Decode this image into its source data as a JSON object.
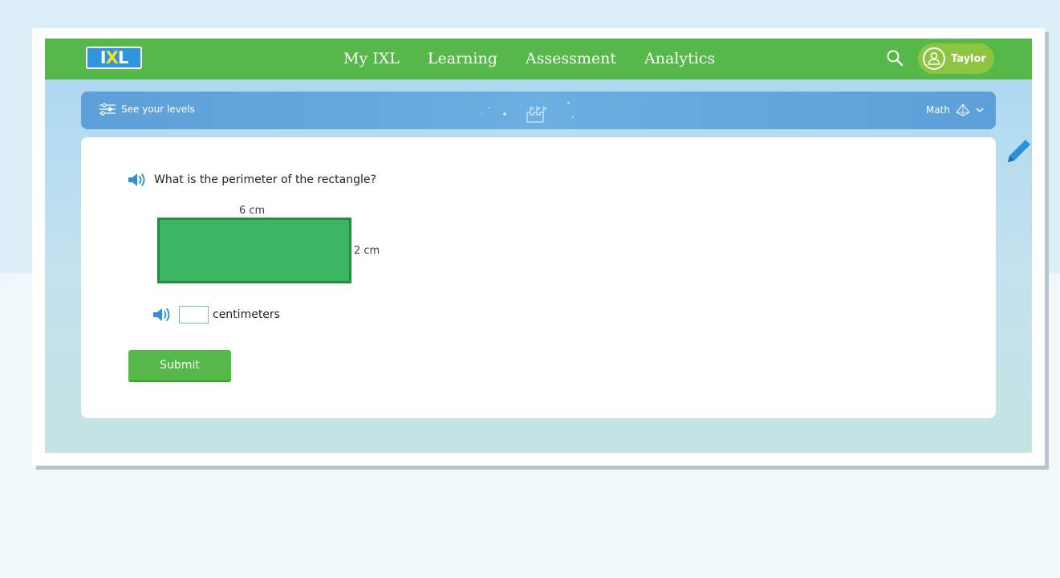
{
  "header": {
    "logo_letters": [
      "I",
      "X",
      "L"
    ],
    "nav": [
      "My IXL",
      "Learning",
      "Assessment",
      "Analytics"
    ],
    "user_name": "Taylor"
  },
  "levels_bar": {
    "label": "See your levels",
    "subject": "Math"
  },
  "question": {
    "prompt": "What is the perimeter of the rectangle?",
    "width_label": "6 cm",
    "height_label": "2 cm",
    "answer_value": "",
    "answer_unit": "centimeters",
    "submit_label": "Submit"
  },
  "colors": {
    "topbar": "#56b848",
    "rectangle_fill": "#3cb562",
    "rectangle_border": "#238c41",
    "speaker": "#2e8fd9"
  },
  "icons": [
    "search-icon",
    "user-avatar-icon",
    "levels-sliders-icon",
    "castle-icon",
    "pyramid-icon",
    "chevron-down-icon",
    "speaker-icon",
    "pencil-icon"
  ]
}
